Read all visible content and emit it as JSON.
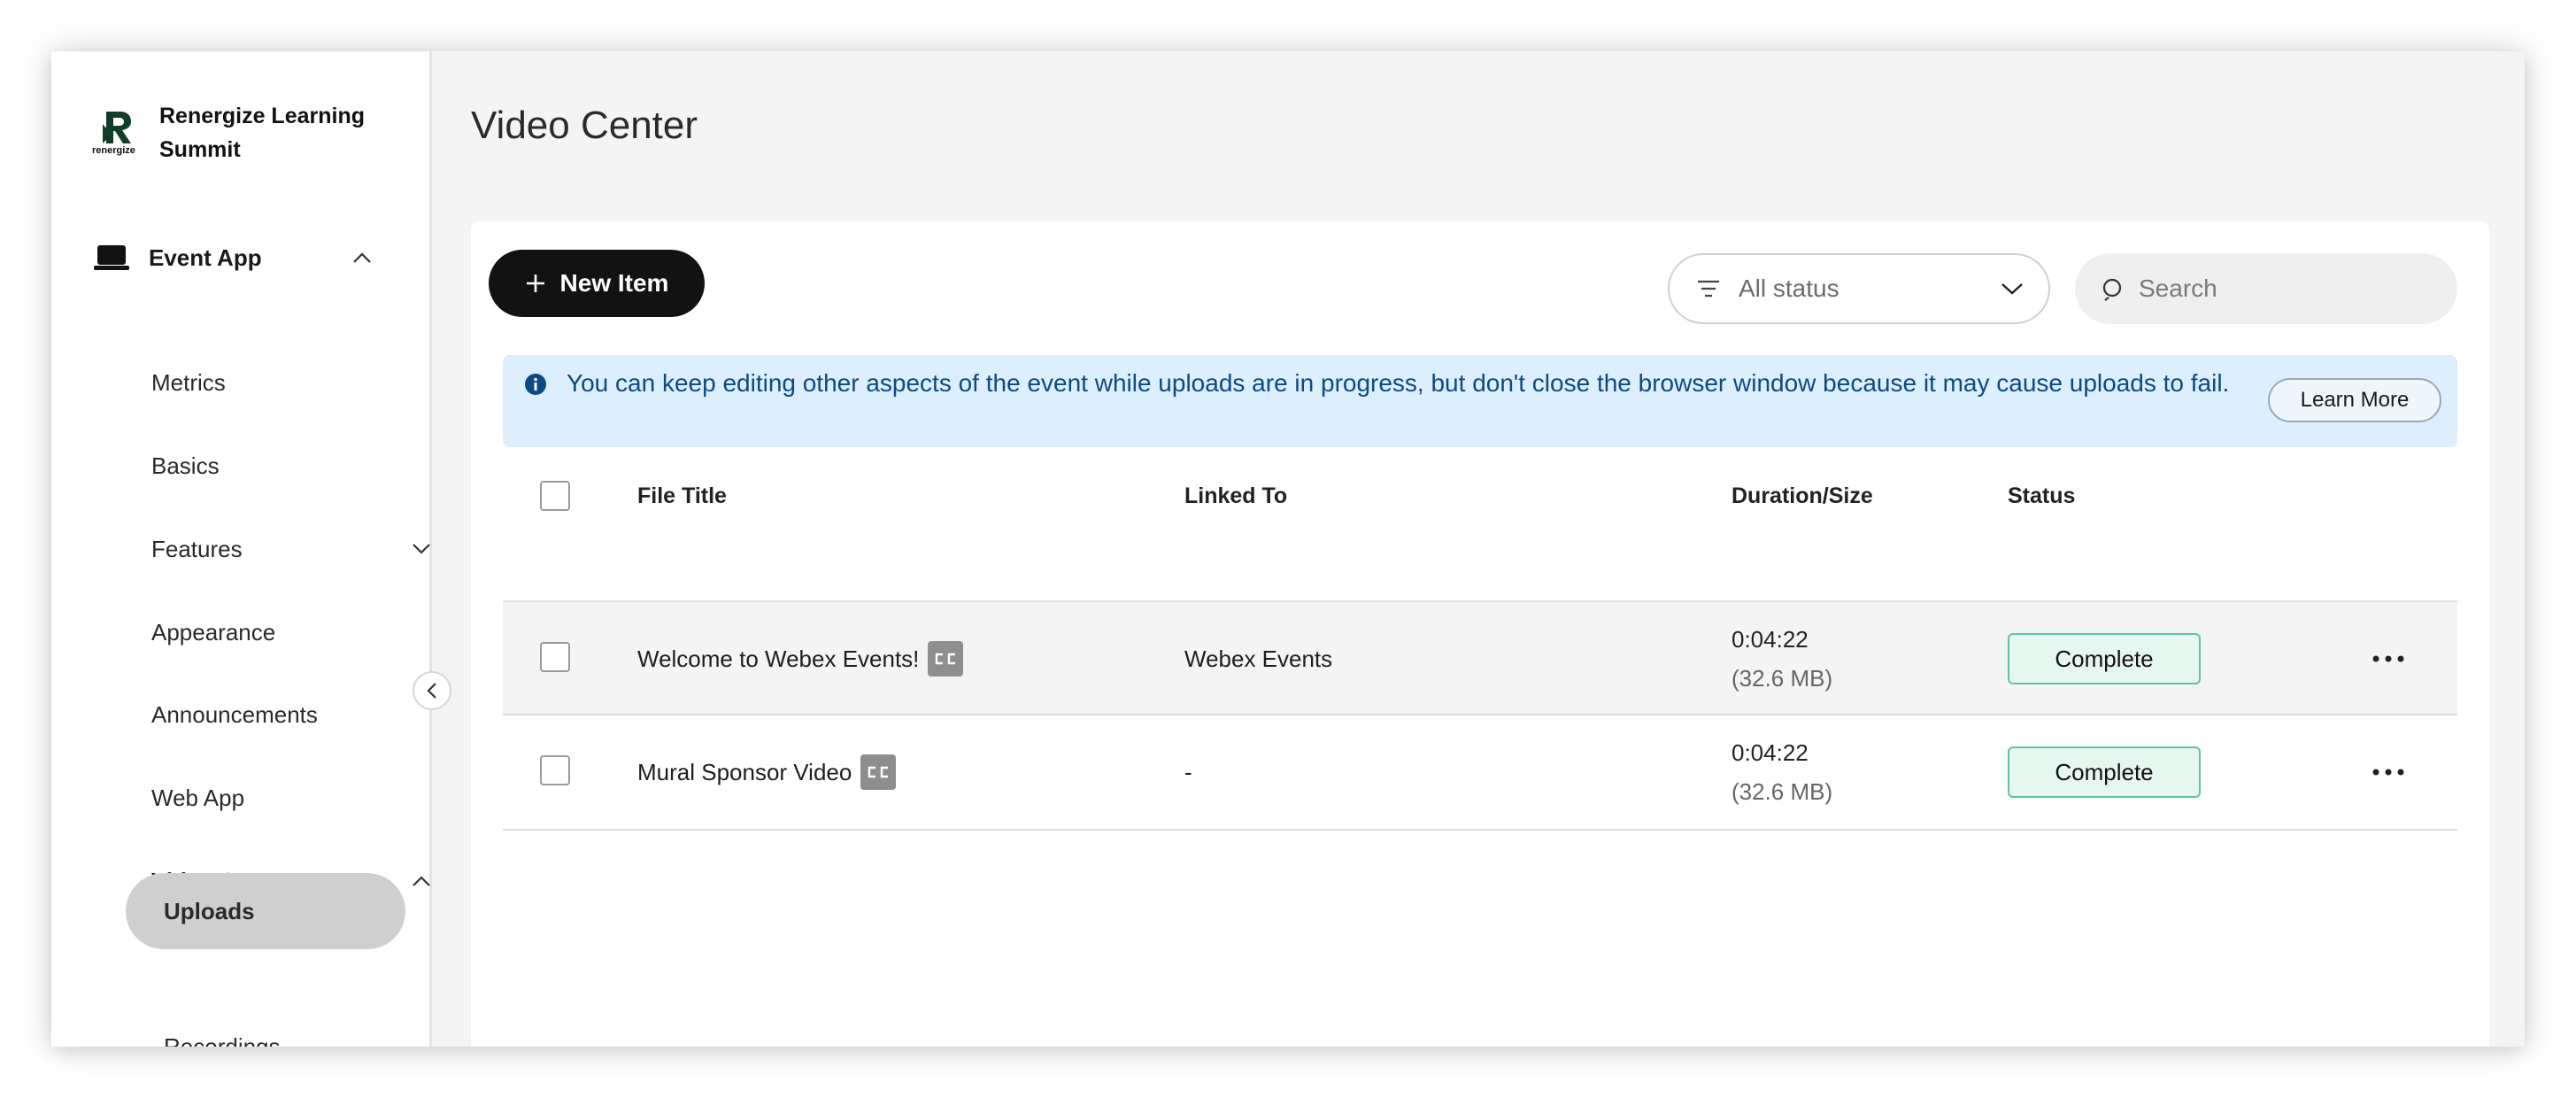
{
  "app": {
    "brand_name": "Renergize Learning Summit",
    "brand_logo_text": "renergize"
  },
  "sidebar": {
    "section": {
      "label": "Event App",
      "expanded": true
    },
    "items": [
      {
        "label": "Metrics"
      },
      {
        "label": "Basics"
      },
      {
        "label": "Features",
        "expandable": true
      },
      {
        "label": "Appearance"
      },
      {
        "label": "Announcements"
      },
      {
        "label": "Web App"
      },
      {
        "label": "Video Center",
        "expanded": true
      }
    ],
    "sub_items": [
      {
        "label": "Uploads",
        "active": true
      },
      {
        "label": "Recordings"
      }
    ]
  },
  "main": {
    "page_title": "Video Center",
    "toolbar": {
      "new_item_label": "New Item",
      "status_filter_value": "All status",
      "search_placeholder": "Search"
    },
    "banner": {
      "text": "You can keep editing other aspects of the event while uploads are in progress, but don't close the browser window because it may cause uploads to fail.",
      "learn_more_label": "Learn More"
    },
    "table": {
      "columns": [
        "File Title",
        "Linked To",
        "Duration/Size",
        "Status"
      ],
      "rows": [
        {
          "title": "Welcome to Webex Events!",
          "linked_to": "Webex Events",
          "duration": "0:04:22",
          "size": "(32.6 MB)",
          "status": "Complete"
        },
        {
          "title": "Mural Sponsor Video",
          "linked_to": "-",
          "duration": "0:04:22",
          "size": "(32.6 MB)",
          "status": "Complete"
        }
      ]
    }
  },
  "colors": {
    "accent_dark": "#121212",
    "banner_bg": "#ddeefc",
    "banner_text": "#0c4a86",
    "status_complete_border": "#5bc5a2",
    "status_complete_bg": "#e6f7f0",
    "nav_active_bg": "#cfcfcf"
  }
}
